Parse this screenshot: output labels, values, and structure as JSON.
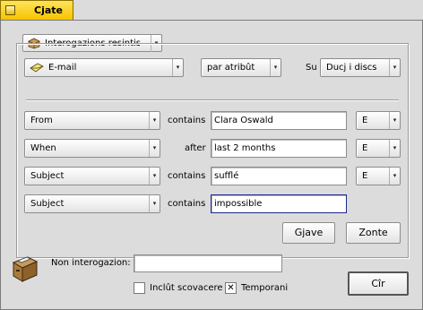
{
  "window": {
    "title": "Cjate"
  },
  "query_menu": {
    "label": "Interogazions resintis"
  },
  "search": {
    "type": "E-mail",
    "by": "par atribût",
    "in_label": "Su",
    "volume": "Ducj i discs"
  },
  "rules": [
    {
      "attribute": "From",
      "operator": "contains",
      "value": "Clara Oswald",
      "conj": "E"
    },
    {
      "attribute": "When",
      "operator": "after",
      "value": "last 2 months",
      "conj": "E"
    },
    {
      "attribute": "Subject",
      "operator": "contains",
      "value": "sufflé",
      "conj": "E"
    },
    {
      "attribute": "Subject",
      "operator": "contains",
      "value": "impossible"
    }
  ],
  "buttons": {
    "remove": "Gjave",
    "add": "Zonte",
    "search": "Cîr"
  },
  "bottom": {
    "name_label": "Non interogazion:",
    "name_value": "",
    "include_trash_label": "Inclût scovacere",
    "include_trash_checked": false,
    "temporary_label": "Temporani",
    "temporary_checked": true,
    "check_mark": "✕"
  },
  "icons": [
    "close-box-icon",
    "package-icon",
    "email-icon",
    "file-cabinet-icon",
    "chevron-down-icon"
  ]
}
